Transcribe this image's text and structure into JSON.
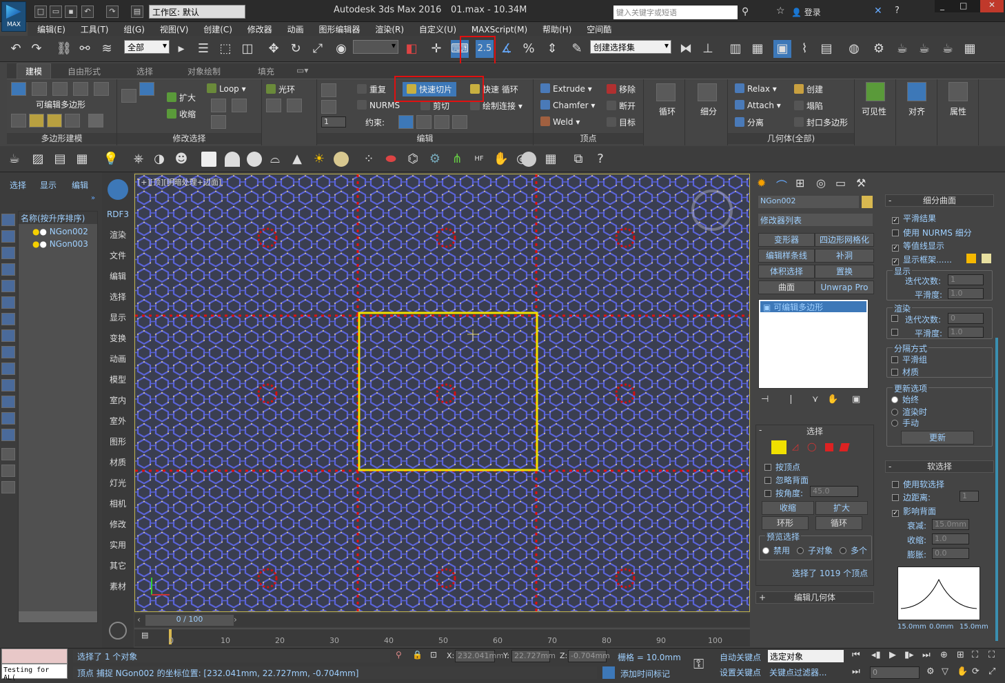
{
  "titlebar": {
    "workspace_label": "工作区: 默认",
    "app_title": "Autodesk 3ds Max 2016",
    "file_info": "01.max - 10.34M",
    "search_placeholder": "键入关键字或短语",
    "login": "登录",
    "logo_text": "MAX"
  },
  "menu": [
    "编辑(E)",
    "工具(T)",
    "组(G)",
    "视图(V)",
    "创建(C)",
    "修改器",
    "动画",
    "图形编辑器",
    "渲染(R)",
    "自定义(U)",
    "MAXScript(M)",
    "帮助(H)",
    "空间酷"
  ],
  "toolbar1": {
    "filter": "全部",
    "selection_set": "创建选择集",
    "snap_label": "2.5"
  },
  "ribbon": {
    "tabs": [
      "建模",
      "自由形式",
      "选择",
      "对象绘制",
      "填充"
    ],
    "groups": {
      "poly_modeling": "多边形建模",
      "modify_selection": "修改选择",
      "edit": "编辑",
      "vertices": "顶点",
      "geometry": "几何体(全部)"
    },
    "editable_poly": "可编辑多边形",
    "grow": "扩大",
    "shrink": "收缩",
    "loop": "Loop",
    "ring": "光环",
    "repeat": "重复",
    "quickslice": "快速切片",
    "swiftloop": "快速 循环",
    "nurms": "NURMS",
    "cut": "剪切",
    "paint_connect": "绘制连接",
    "constraints": "约束:",
    "constraint_value": "1",
    "extrude": "Extrude",
    "chamfer": "Chamfer",
    "weld": "Weld",
    "remove": "移除",
    "break": "断开",
    "target": "目标",
    "loop_big": "循环",
    "subdivide": "细分",
    "relax": "Relax",
    "attach": "Attach",
    "detach": "分离",
    "create": "创建",
    "collapse": "塌陷",
    "cap_poly": "封口多边形",
    "visibility": "可见性",
    "align": "对齐",
    "properties": "属性"
  },
  "left": {
    "tabs": [
      "选择",
      "显示",
      "编辑"
    ],
    "header": "名称(按升序排序)",
    "objects": [
      "NGon002",
      "NGon003"
    ]
  },
  "leftnav": [
    "RDF3",
    "渲染",
    "文件",
    "编辑",
    "选择",
    "显示",
    "变换",
    "动画",
    "模型",
    "室内",
    "室外",
    "图形",
    "材质",
    "灯光",
    "相机",
    "修改",
    "实用",
    "其它",
    "素材"
  ],
  "viewport": {
    "label": "[+][顶][明暗处理+边面]"
  },
  "modify": {
    "object_name": "NGon002",
    "modifier_list": "修改器列表",
    "buttons": [
      "变形器",
      "四边形网格化",
      "编辑样条线",
      "补洞",
      "体积选择",
      "置换",
      "曲面",
      "Unwrap Pro"
    ],
    "stack_item": "可编辑多边形"
  },
  "selection": {
    "title": "选择",
    "by_vertex": "按顶点",
    "ignore_backface": "忽略背面",
    "by_angle": "按角度:",
    "angle_value": "45.0",
    "shrink": "收缩",
    "grow": "扩大",
    "ring": "环形",
    "loop": "循环",
    "preview_title": "预览选择",
    "preview_off": "禁用",
    "preview_sub": "子对象",
    "preview_multi": "多个",
    "status": "选择了 1019 个顶点"
  },
  "edit_geometry": "编辑几何体",
  "subdivision": {
    "title": "细分曲面",
    "smooth_result": "平滑结果",
    "use_nurms": "使用 NURMS 细分",
    "isoline": "等值线显示",
    "show_cage": "显示框架......",
    "display": "显示",
    "iterations": "迭代次数:",
    "iter_value": "1",
    "smoothness": "平滑度:",
    "smooth_value": "1.0",
    "render": "渲染",
    "r_iter_value": "0",
    "r_smooth_value": "1.0",
    "sep_title": "分隔方式",
    "smoothing_groups": "平滑组",
    "materials": "材质",
    "update_title": "更新选项",
    "always": "始终",
    "when_render": "渲染时",
    "manual": "手动",
    "update_btn": "更新"
  },
  "soft": {
    "title": "软选择",
    "use_soft": "使用软选择",
    "edge_dist": "边距离:",
    "edge_value": "1",
    "affect_back": "影响背面",
    "falloff": "衰减:",
    "falloff_value": "15.0mm",
    "pinch": "收缩:",
    "pinch_value": "1.0",
    "bubble": "膨胀:",
    "bubble_value": "0.0",
    "curve_labels": [
      "15.0mm",
      "0.0mm",
      "15.0mm"
    ]
  },
  "timeline": {
    "frame": "0 / 100",
    "ticks": [
      "0",
      "10",
      "20",
      "30",
      "40",
      "50",
      "60",
      "70",
      "80",
      "90",
      "100"
    ]
  },
  "status": {
    "maxscript": "Testing for AL(",
    "selected": "选择了 1 个对象",
    "prompt": "顶点 捕捉 NGon002 的坐标位置: [232.041mm, 22.727mm, -0.704mm]",
    "x": "232.041mm",
    "y": "22.727mm",
    "z": "-0.704mm",
    "grid": "栅格 = 10.0mm",
    "add_time_tag": "添加时间标记",
    "auto_key": "自动关键点",
    "set_key": "设置关键点",
    "key_filter": "关键点过滤器...",
    "selected_object": "选定对象",
    "frame_field": "0"
  }
}
